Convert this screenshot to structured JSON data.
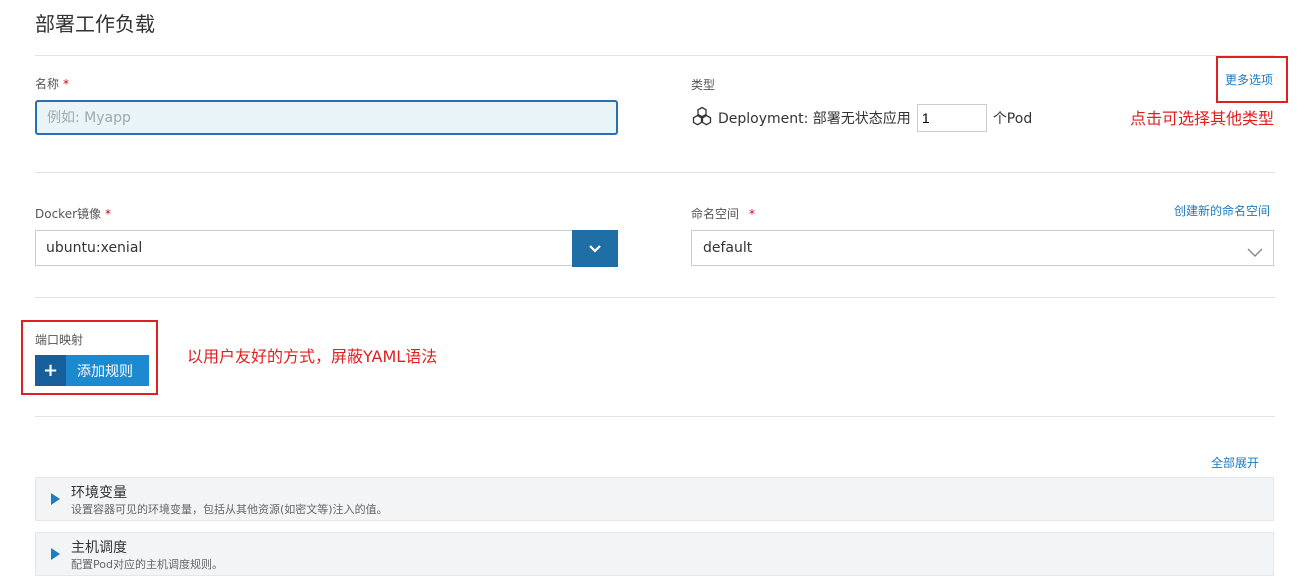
{
  "page": {
    "title": "部署工作负载"
  },
  "name_field": {
    "label": "名称",
    "required_mark": "*",
    "placeholder": "例如: Myapp"
  },
  "type_field": {
    "label": "类型",
    "more_options": "更多选项",
    "description": "Deployment: 部署无状态应用",
    "scale_value": "1",
    "unit": "个Pod",
    "icon": "deployment-icon"
  },
  "annotations": {
    "more_options_note": "点击可选择其他类型",
    "port_note": "以用户友好的方式，屏蔽YAML语法"
  },
  "image_field": {
    "label": "Docker镜像",
    "required_mark": "*",
    "value": "ubuntu:xenial"
  },
  "namespace_field": {
    "label": "命名空间",
    "required_mark": "*",
    "create_link": "创建新的命名空间",
    "value": "default"
  },
  "ports": {
    "label": "端口映射",
    "add_button": "添加规则",
    "add_icon": "+"
  },
  "expand_all": "全部展开",
  "sections": [
    {
      "title": "环境变量",
      "description": "设置容器可见的环境变量，包括从其他资源(如密文等)注入的值。"
    },
    {
      "title": "主机调度",
      "description": "配置Pod对应的主机调度规则。"
    }
  ],
  "colors": {
    "accent": "#1d8ad0",
    "annotation": "#e02020",
    "focus_border": "#2a6fb0"
  }
}
